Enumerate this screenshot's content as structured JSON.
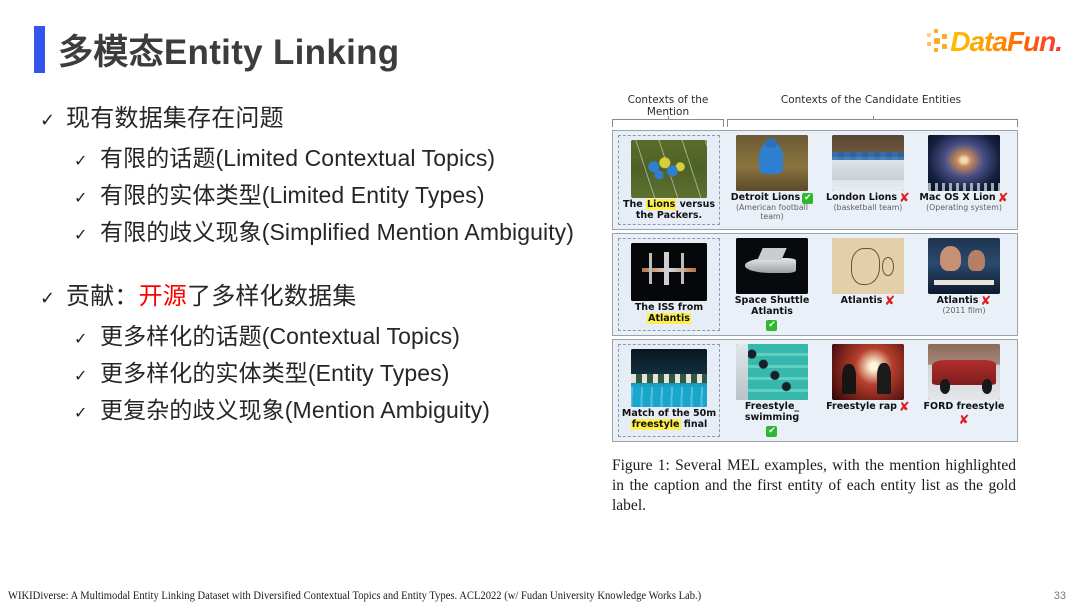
{
  "slide": {
    "title": "多模态Entity Linking",
    "accent_color": "#3355ee",
    "logo_text": "DataFun."
  },
  "bullets": [
    {
      "level": 1,
      "text": "现有数据集存在问题",
      "tick": "✓"
    },
    {
      "level": 2,
      "text": "有限的话题(Limited Contextual Topics)",
      "tick": "✓"
    },
    {
      "level": 2,
      "text": "有限的实体类型(Limited Entity Types)",
      "tick": "✓"
    },
    {
      "level": 2,
      "text": "有限的歧义现象(Simplified Mention Ambiguity)",
      "tick": "✓"
    }
  ],
  "bullets2": [
    {
      "level": 1,
      "tick": "✓",
      "prefix": "贡献：",
      "highlight": "开源",
      "suffix": "了多样化数据集",
      "highlight_color": "#ff0000"
    },
    {
      "level": 2,
      "text": "更多样化的话题(Contextual Topics)",
      "tick": "✓"
    },
    {
      "level": 2,
      "text": "更多样化的实体类型(Entity Types)",
      "tick": "✓"
    },
    {
      "level": 2,
      "text": "更复杂的歧义现象(Mention Ambiguity)",
      "tick": "✓"
    }
  ],
  "figure": {
    "header_mention": "Contexts of the Mention",
    "header_candidates": "Contexts of the Candidate Entities",
    "mark_correct": "✔",
    "mark_wrong": "✘",
    "rows": [
      {
        "mention": {
          "caption_before": "The ",
          "caption_highlight": "Lions",
          "caption_after": " versus the Packers.",
          "art": "art-football"
        },
        "candidates": [
          {
            "label": "Detroit Lions",
            "sub": "(American football team)",
            "mark": "ok",
            "art": "art-player"
          },
          {
            "label": "London Lions",
            "sub": "(basketball team)",
            "mark": "no",
            "art": "art-arena"
          },
          {
            "label": "Mac OS X Lion",
            "sub": "(Operating system)",
            "mark": "no",
            "art": "art-galaxy"
          }
        ]
      },
      {
        "mention": {
          "caption_before": "The ISS from ",
          "caption_highlight": "Atlantis",
          "caption_after": "",
          "art": "art-iss"
        },
        "candidates": [
          {
            "label": "Space Shuttle Atlantis",
            "sub": "",
            "mark": "ok",
            "art": "art-shuttle"
          },
          {
            "label": "Atlantis",
            "sub": "",
            "mark": "no",
            "art": "art-map"
          },
          {
            "label": "Atlantis",
            "sub": "(2011 film)",
            "mark": "no",
            "art": "art-poster"
          }
        ]
      },
      {
        "mention": {
          "caption_before": "Match of the 50m ",
          "caption_highlight": "freestyle",
          "caption_after": " final",
          "art": "art-swimfinal"
        },
        "candidates": [
          {
            "label": "Freestyle_ swimming",
            "sub": "",
            "mark": "ok",
            "art": "art-swimlanes"
          },
          {
            "label": "Freestyle rap",
            "sub": "",
            "mark": "no",
            "art": "art-rap"
          },
          {
            "label": "FORD freestyle",
            "sub": "",
            "mark": "no",
            "art": "art-car"
          }
        ]
      }
    ],
    "caption": "Figure 1: Several MEL examples, with the mention highlighted in the caption and the first entity of each entity list as the gold label."
  },
  "footer": {
    "citation": "WIKIDiverse: A Multimodal Entity Linking Dataset with Diversified Contextual Topics and Entity Types. ACL2022  (w/ Fudan University Knowledge Works Lab.)",
    "page_number": "33"
  }
}
